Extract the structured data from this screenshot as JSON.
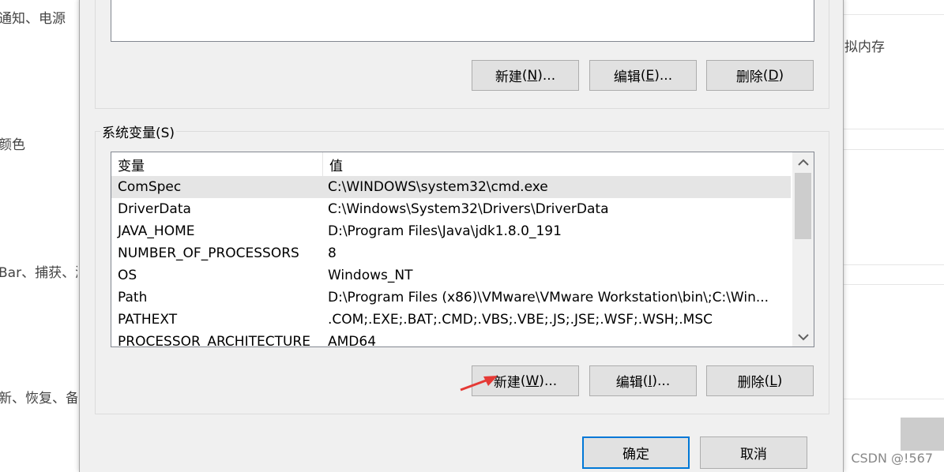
{
  "background": {
    "left_items": [
      "通知、电源",
      "颜色",
      "Bar、捕获、游",
      "新、恢复、备份"
    ],
    "right_item": "拟内存"
  },
  "user_vars": {
    "buttons": {
      "new": {
        "label": "新建",
        "key": "N",
        "suffix": "..."
      },
      "edit": {
        "label": "编辑",
        "key": "E",
        "suffix": "..."
      },
      "delete": {
        "label": "删除",
        "key": "D",
        "suffix": ""
      }
    }
  },
  "system_vars": {
    "group_label": "系统变量(S)",
    "columns": {
      "name": "变量",
      "value": "值"
    },
    "rows": [
      {
        "name": "ComSpec",
        "value": "C:\\WINDOWS\\system32\\cmd.exe",
        "selected": true
      },
      {
        "name": "DriverData",
        "value": "C:\\Windows\\System32\\Drivers\\DriverData"
      },
      {
        "name": "JAVA_HOME",
        "value": "D:\\Program Files\\Java\\jdk1.8.0_191"
      },
      {
        "name": "NUMBER_OF_PROCESSORS",
        "value": "8"
      },
      {
        "name": "OS",
        "value": "Windows_NT"
      },
      {
        "name": "Path",
        "value": "D:\\Program Files (x86)\\VMware\\VMware Workstation\\bin\\;C:\\Win..."
      },
      {
        "name": "PATHEXT",
        "value": ".COM;.EXE;.BAT;.CMD;.VBS;.VBE;.JS;.JSE;.WSF;.WSH;.MSC"
      },
      {
        "name": "PROCESSOR_ARCHITECTURE",
        "value": "AMD64"
      }
    ],
    "buttons": {
      "new": {
        "label": "新建",
        "key": "W",
        "suffix": "..."
      },
      "edit": {
        "label": "编辑",
        "key": "I",
        "suffix": "..."
      },
      "delete": {
        "label": "删除",
        "key": "L",
        "suffix": ""
      }
    }
  },
  "dialog_buttons": {
    "ok": "确定",
    "cancel": "取消"
  },
  "watermark": "CSDN @!567",
  "colors": {
    "annotation_arrow": "#e53935",
    "selection": "#e5e5e5",
    "default_button_border": "#0078d7"
  },
  "icons": {
    "scroll_up": "chevron-up-icon",
    "scroll_down": "chevron-down-icon",
    "annotation": "arrow-annotation-icon"
  }
}
